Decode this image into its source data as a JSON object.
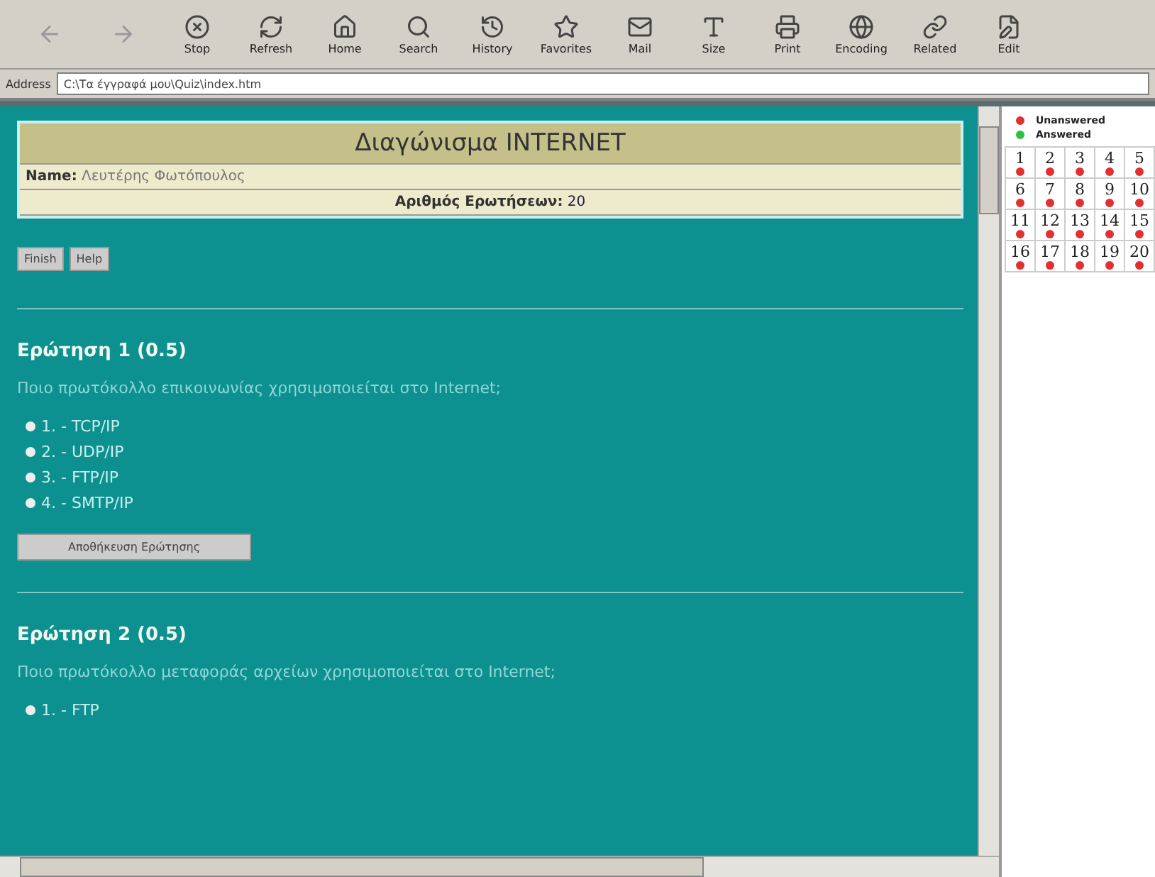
{
  "toolbar": {
    "buttons": [
      {
        "disabled": true
      },
      {
        "disabled": true
      },
      {
        "label": "Stop",
        "disabled": false
      },
      {
        "label": "Refresh",
        "disabled": false
      },
      {
        "label": "Home",
        "disabled": false
      },
      {
        "label": "Search",
        "disabled": false
      },
      {
        "label": "History",
        "disabled": false
      },
      {
        "label": "Favorites",
        "disabled": false
      },
      {
        "label": "Mail",
        "disabled": false
      },
      {
        "label": "Size",
        "disabled": false
      },
      {
        "label": "Print",
        "disabled": false
      },
      {
        "label": "Encoding",
        "disabled": false
      },
      {
        "label": "Related",
        "disabled": false
      },
      {
        "label": "Edit",
        "disabled": false
      }
    ]
  },
  "address_bar": {
    "label": "Address",
    "value": "C:\\Τα έγγραφά μου\\Quiz\\index.htm"
  },
  "header": {
    "title": "Διαγώνισμα INTERNET",
    "name_label": "Name:",
    "name_value": "Λευτέρης Φωτόπουλος",
    "count_label": "Αριθμός Ερωτήσεων:",
    "count_value": "20"
  },
  "actions": [
    "Finish",
    "Help"
  ],
  "questions": [
    {
      "title": "Ερώτηση 1  (0.5)",
      "text": "Ποιο πρωτόκολλο επικοινωνίας χρησιμοποιείται στο Internet;",
      "options": [
        {
          "label": "1. - TCP/IP",
          "selected": false
        },
        {
          "label": "2. - UDP/IP",
          "selected": false
        },
        {
          "label": "3. - FTP/IP",
          "selected": false
        },
        {
          "label": "4. - SMTP/IP",
          "selected": false
        }
      ],
      "save": "Αποθήκευση Ερώτησης"
    },
    {
      "title": "Ερώτηση 2  (0.5)",
      "text": "Ποιο πρωτόκολλο μεταφοράς αρχείων χρησιμοποιείται στο Internet;",
      "options": [
        {
          "label": "1. - FTP",
          "selected": false
        }
      ]
    }
  ],
  "legend": [
    {
      "label": "Unanswered",
      "color": "#e03030"
    },
    {
      "label": "Answered",
      "color": "#30c040"
    }
  ],
  "grid": [
    {
      "number": "1",
      "answered": false
    },
    {
      "number": "2",
      "answered": false
    },
    {
      "number": "3",
      "answered": false
    },
    {
      "number": "4",
      "answered": false
    },
    {
      "number": "5",
      "answered": false
    },
    {
      "number": "6",
      "answered": false
    },
    {
      "number": "7",
      "answered": false
    },
    {
      "number": "8",
      "answered": false
    },
    {
      "number": "9",
      "answered": false
    },
    {
      "number": "10",
      "answered": false
    },
    {
      "number": "11",
      "answered": false
    },
    {
      "number": "12",
      "answered": false
    },
    {
      "number": "13",
      "answered": false
    },
    {
      "number": "14",
      "answered": false
    },
    {
      "number": "15",
      "answered": false
    },
    {
      "number": "16",
      "answered": false
    },
    {
      "number": "17",
      "answered": false
    },
    {
      "number": "18",
      "answered": false
    },
    {
      "number": "19",
      "answered": false
    },
    {
      "number": "20",
      "answered": false
    }
  ]
}
